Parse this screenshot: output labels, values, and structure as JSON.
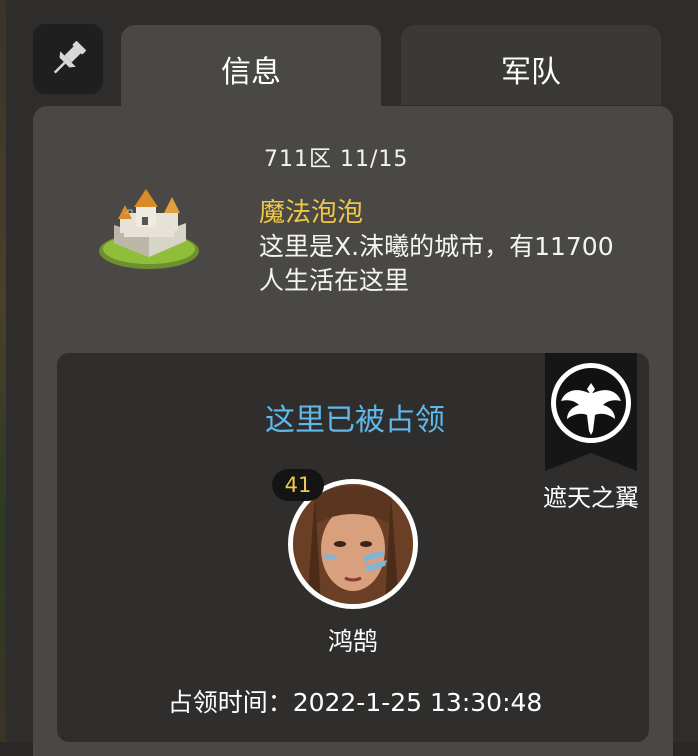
{
  "tabs": [
    {
      "label": "信息"
    },
    {
      "label": "军队"
    }
  ],
  "city": {
    "region": "711区 11/15",
    "name": "魔法泡泡",
    "description": "这里是X.沫曦的城市，有11700人生活在这里"
  },
  "occupation": {
    "title": "这里已被占领",
    "alliance_name": "遮天之翼",
    "lord_level": "41",
    "lord_name": "鸿鹄",
    "time_label": "占领时间：2022-1-25 13:30:48"
  },
  "icons": {
    "pin": "pin-icon",
    "castle": "castle-icon",
    "alliance": "eagle-banner-icon"
  },
  "colors": {
    "city_name": "#f0c648",
    "occupied_title": "#5fb8ea",
    "level_text": "#f2c94c"
  }
}
